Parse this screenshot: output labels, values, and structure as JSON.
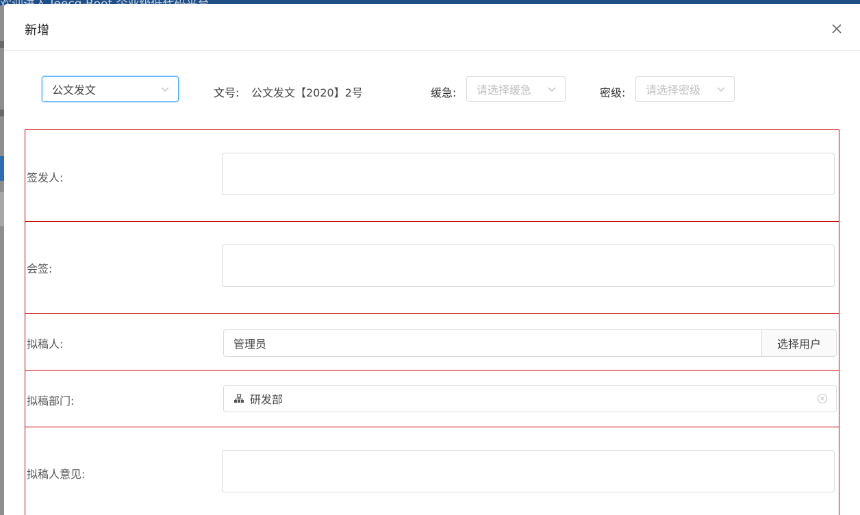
{
  "background": {
    "header_title": "欢迎进入 Jeecg-Boot 企业级低代码平台"
  },
  "modal": {
    "title": "新增",
    "close_icon": "close-icon"
  },
  "top_row": {
    "doc_type_value": "公文发文",
    "doc_number_label": "文号:",
    "doc_number_value": "公文发文【2020】2号",
    "urgency_label": "缓急:",
    "urgency_placeholder": "请选择缓急",
    "secret_label": "密级:",
    "secret_placeholder": "请选择密级"
  },
  "form": {
    "signer_label": "签发人:",
    "countersign_label": "会签:",
    "drafter_label": "拟稿人:",
    "drafter_value": "管理员",
    "select_user_label": "选择用户",
    "dept_label": "拟稿部门:",
    "dept_value": "研发部",
    "opinion_label": "拟稿人意见:"
  },
  "colors": {
    "row_border": "#c40000",
    "active_border": "#40a9ff"
  }
}
